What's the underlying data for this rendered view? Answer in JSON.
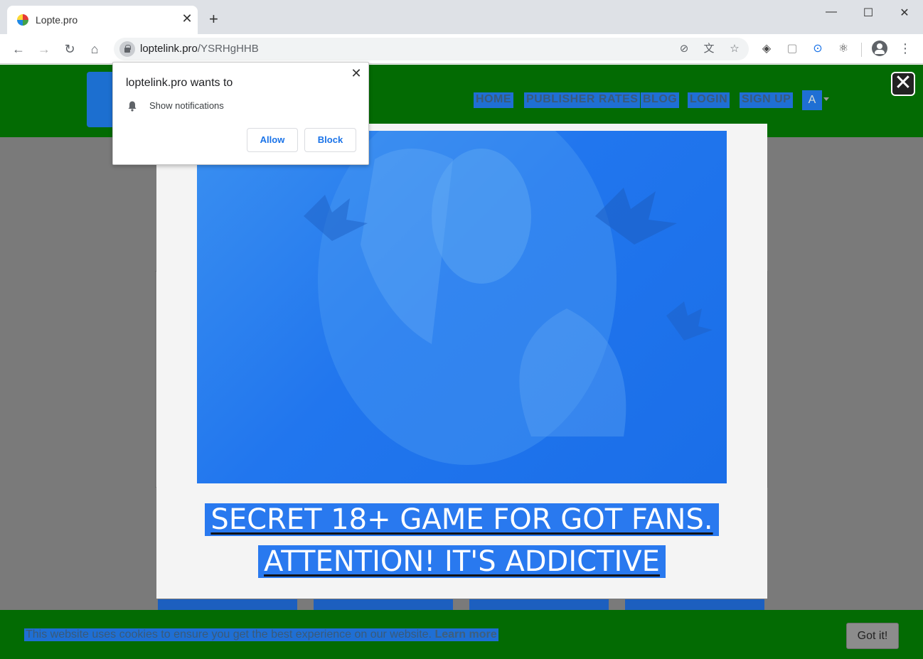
{
  "browser": {
    "tab_title": "Lopte.pro",
    "tab_close": "✕",
    "new_tab": "+",
    "window_min": "—",
    "window_max": "☐",
    "window_close": "✕",
    "url_host": "loptelink.pro",
    "url_path": "/YSRHgHHB"
  },
  "permission_popup": {
    "title": "loptelink.pro wants to",
    "item": "Show notifications",
    "close": "✕",
    "allow": "Allow",
    "block": "Block"
  },
  "site": {
    "nav": [
      "HOME",
      "PUBLISHER RATES",
      "BLOG",
      "LOGIN",
      "SIGN UP"
    ]
  },
  "ad": {
    "headline_line1": "SECRET 18+ GAME FOR GOT FANS.",
    "headline_line2": "ATTENTION! IT'S ADDICTIVE",
    "close": "✕"
  },
  "cookie": {
    "text": "This website uses cookies to ensure you get the best experience on our website.",
    "link": "Learn more",
    "button": "Got it!"
  },
  "colors": {
    "site_green": "#036b03",
    "highlight_blue": "#1f6fd4",
    "chrome_blue": "#1a73e8"
  }
}
